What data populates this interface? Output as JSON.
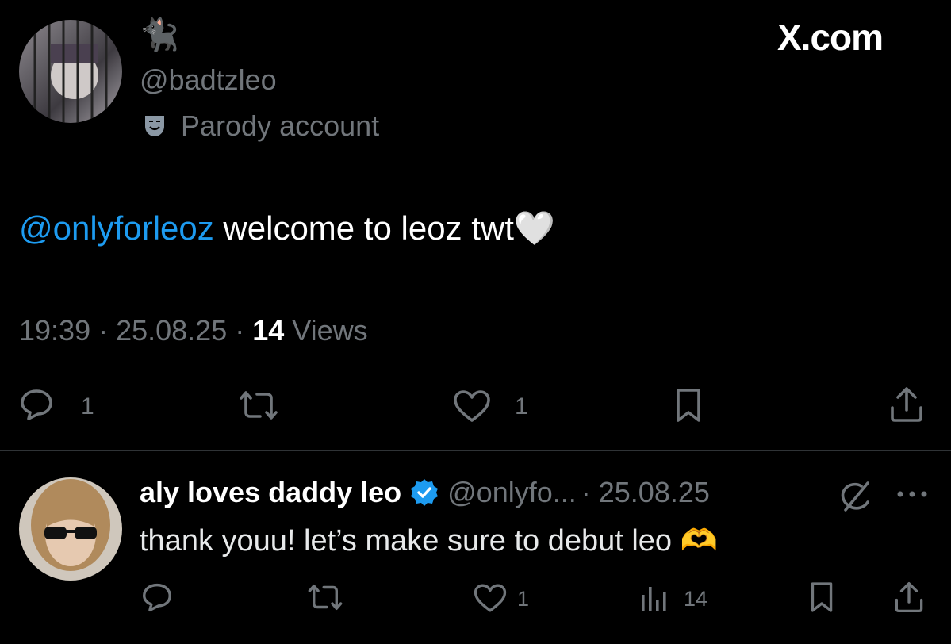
{
  "watermark": "X.com",
  "post": {
    "display_name": "🐈‍⬛",
    "handle": "@badtzleo",
    "label": "Parody account",
    "mention": "@onlyforleoz",
    "text": " welcome to leoz twt",
    "text_emoji": "🤍",
    "meta_time": "19:39 · 25.08.25 · ",
    "meta_views_count": "14",
    "meta_views_label": " Views",
    "actions": {
      "replies": "1",
      "likes": "1"
    }
  },
  "reply": {
    "display_name": "aly loves daddy leo",
    "handle": "@onlyfo...",
    "date": "· 25.08.25",
    "text": "thank youu! let’s make sure to debut leo ",
    "text_emoji": "🫶",
    "actions": {
      "likes": "1",
      "views": "14"
    }
  },
  "colors": {
    "accent": "#1d9bf0",
    "muted": "#71767b",
    "text": "#e7e9ea",
    "divider": "#2f3336"
  }
}
